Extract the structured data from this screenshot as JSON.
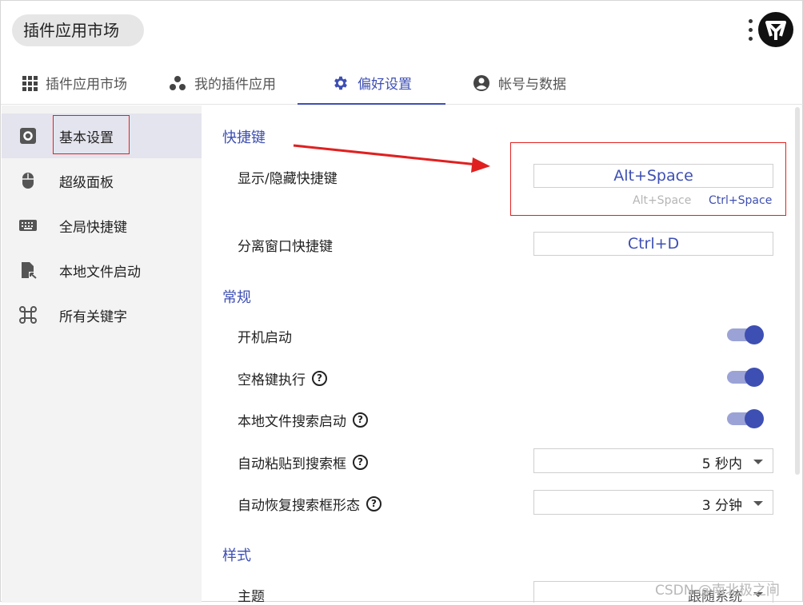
{
  "header": {
    "search_value": "插件应用市场"
  },
  "tabs": [
    {
      "label": "插件应用市场",
      "icon": "grid-icon"
    },
    {
      "label": "我的插件应用",
      "icon": "dots-icon"
    },
    {
      "label": "偏好设置",
      "icon": "gear-icon",
      "active": true
    },
    {
      "label": "帐号与数据",
      "icon": "account-icon"
    }
  ],
  "sidebar": {
    "items": [
      {
        "label": "基本设置",
        "icon": "settings-icon",
        "active": true
      },
      {
        "label": "超级面板",
        "icon": "mouse-icon"
      },
      {
        "label": "全局快捷键",
        "icon": "keyboard-icon"
      },
      {
        "label": "本地文件启动",
        "icon": "file-launch-icon"
      },
      {
        "label": "所有关键字",
        "icon": "command-icon"
      }
    ]
  },
  "sections": {
    "shortcuts": {
      "title": "快捷键",
      "show_hide": {
        "label": "显示/隐藏快捷键",
        "value": "Alt+Space",
        "option_1": "Alt+Space",
        "option_2": "Ctrl+Space"
      },
      "detach": {
        "label": "分离窗口快捷键",
        "value": "Ctrl+D"
      }
    },
    "general": {
      "title": "常规",
      "autostart": {
        "label": "开机启动",
        "on": true
      },
      "space_exec": {
        "label": "空格键执行",
        "on": true
      },
      "local_search": {
        "label": "本地文件搜索启动",
        "on": true
      },
      "auto_paste": {
        "label": "自动粘贴到搜索框",
        "value": "5 秒内"
      },
      "auto_restore": {
        "label": "自动恢复搜索框形态",
        "value": "3 分钟"
      }
    },
    "style": {
      "title": "样式",
      "theme": {
        "label": "主题",
        "value": "跟随系统"
      }
    }
  },
  "help_glyph": "?",
  "watermark": "CSDN @南北极之间",
  "colors": {
    "accent": "#3e4fb3",
    "toggle_track": "#9ba3d6",
    "annotation_red": "#e02020",
    "sidebar_bg": "#f3f3f3",
    "sidebar_active": "#e4e4ee"
  }
}
